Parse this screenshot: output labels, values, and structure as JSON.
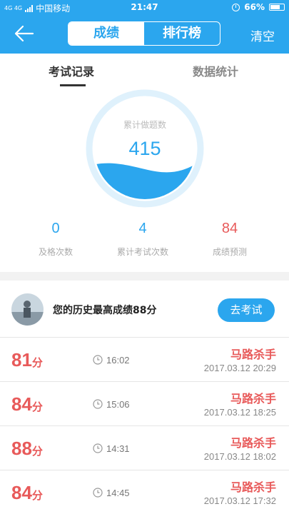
{
  "status_bar": {
    "network": "4G 4G",
    "carrier": "中国移动",
    "time": "21:47",
    "battery": "66%",
    "icons": [
      "signal-icon",
      "alarm-icon",
      "battery-icon"
    ]
  },
  "header": {
    "back_icon": "arrow-left-icon",
    "segments": [
      {
        "label": "成绩",
        "active": true
      },
      {
        "label": "排行榜",
        "active": false
      }
    ],
    "clear_label": "清空",
    "accent_color": "#2ba6ee"
  },
  "subtabs": [
    {
      "label": "考试记录",
      "active": true
    },
    {
      "label": "数据统计",
      "active": false
    }
  ],
  "gauge": {
    "title": "累计做题数",
    "value": "415",
    "fill_fraction": 0.4
  },
  "stats": [
    {
      "value": "0",
      "label": "及格次数",
      "color": "#2ba6ee"
    },
    {
      "value": "4",
      "label": "累计考试次数",
      "color": "#2ba6ee"
    },
    {
      "value": "84",
      "label": "成绩预测",
      "color": "#e85a5a"
    }
  ],
  "best": {
    "text": "您的历史最高成绩88分",
    "button_label": "去考试"
  },
  "records": [
    {
      "score": "81",
      "unit": "分",
      "duration": "16:02",
      "name": "马路杀手",
      "date": "2017.03.12  20:29"
    },
    {
      "score": "84",
      "unit": "分",
      "duration": "15:06",
      "name": "马路杀手",
      "date": "2017.03.12  18:25"
    },
    {
      "score": "88",
      "unit": "分",
      "duration": "14:31",
      "name": "马路杀手",
      "date": "2017.03.12  18:02"
    },
    {
      "score": "84",
      "unit": "分",
      "duration": "14:45",
      "name": "马路杀手",
      "date": "2017.03.12  17:32"
    }
  ]
}
